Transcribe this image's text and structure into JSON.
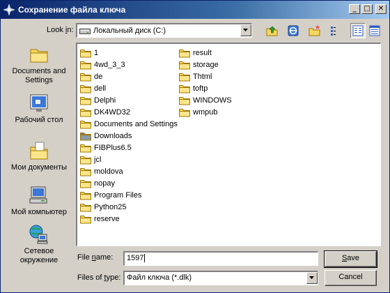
{
  "window": {
    "title": "Сохранение файла ключа",
    "minimize_glyph": "_",
    "maximize_glyph": "□",
    "close_glyph": "✕"
  },
  "lookin": {
    "label_pre": "Look ",
    "label_ul": "i",
    "label_post": "n:",
    "value": "Локальный диск (C:)"
  },
  "places": [
    {
      "label": "Documents and Settings",
      "icon": "folder-icon"
    },
    {
      "label": "Рабочий стол",
      "icon": "desktop-icon"
    },
    {
      "label": "Мои документы",
      "icon": "my-documents-icon"
    },
    {
      "label": "Мой компьютер",
      "icon": "my-computer-icon"
    },
    {
      "label": "Сетевое окружение",
      "icon": "network-icon"
    }
  ],
  "files": {
    "column1": [
      "1",
      "4wd_3_3",
      "de",
      "dell",
      "Delphi",
      "DK4WD32",
      "Documents and Settings",
      "Downloads",
      "FIBPlus6.5",
      "jcl",
      "moldova",
      "nopay",
      "Program Files",
      "Python25",
      "reserve"
    ],
    "column2": [
      "result",
      "storage",
      "Thtml",
      "toftp",
      "WINDOWS",
      "wmpub"
    ]
  },
  "filename": {
    "label_pre": "File ",
    "label_ul": "n",
    "label_post": "ame:",
    "value": "1597"
  },
  "filetype": {
    "label_pre": "Files of ",
    "label_ul": "t",
    "label_post": "ype:",
    "value": "Файл ключа (*.dlk)"
  },
  "buttons": {
    "save_ul": "S",
    "save_rest": "ave",
    "cancel": "Cancel"
  },
  "colors": {
    "titlebar_start": "#0a246a",
    "titlebar_end": "#a6caf0",
    "face": "#d4d0c8",
    "folder": "#f8d860"
  }
}
